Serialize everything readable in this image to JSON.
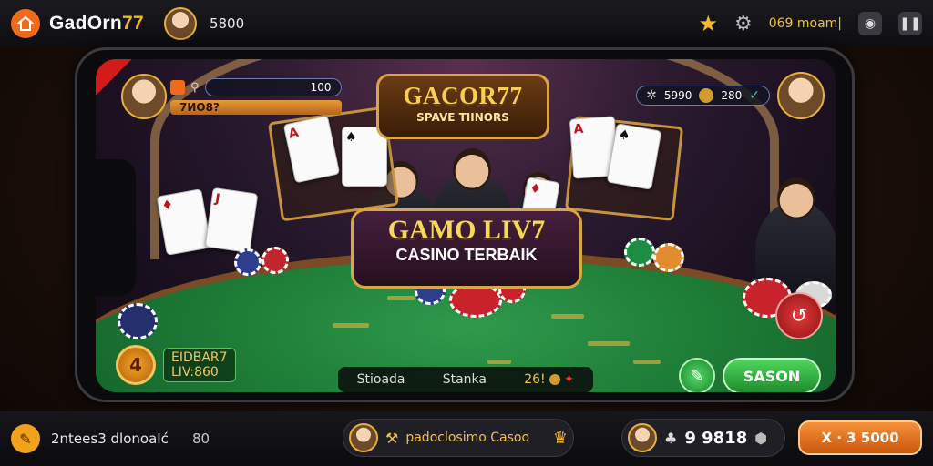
{
  "topbar": {
    "brand_prefix": "GadOrn",
    "brand_suffix": "77",
    "balance": "5800",
    "stats": "069 moam|"
  },
  "phone": {
    "player_left": {
      "chips": "100",
      "label": "7ИО8?"
    },
    "player_right": {
      "value": "5990",
      "chips": "280"
    },
    "logo": {
      "main": "GACOR77",
      "sub": "SPAVE TIINORS"
    },
    "banner": {
      "main": "GAMO LIV7",
      "sub": "CASINO TERBAIK"
    },
    "cards": {
      "left_rank": "A",
      "center_rank": "J",
      "right_rank": "A"
    },
    "bet": {
      "title": "EIDBAR7",
      "level": "LIV:860"
    },
    "center_bar": {
      "left": "Stioada",
      "middle": "Stanka",
      "right": "26!"
    },
    "season_button": "SASON"
  },
  "bottombar": {
    "left_text": "2ntees3 dlonoaIć",
    "left_num": "80",
    "mid_label": "padoclosimo Casoo",
    "score": "9 9818",
    "action_button": "X · 3 5000"
  },
  "colors": {
    "accent_orange": "#f06a1c",
    "gold": "#d9a641",
    "felt_green": "#1c7a35",
    "season_green": "#1d8c2d"
  }
}
